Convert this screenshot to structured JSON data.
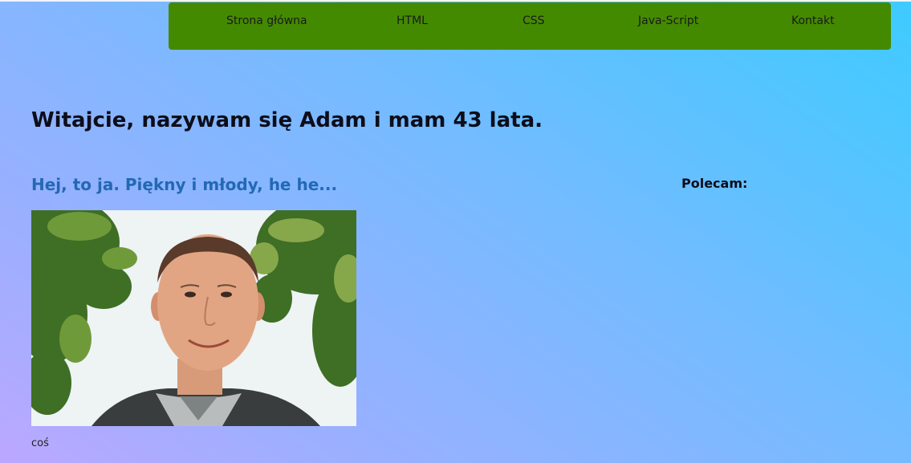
{
  "nav": {
    "items": [
      "Strona główna",
      "HTML",
      "CSS",
      "Java-Script",
      "Kontakt"
    ]
  },
  "main": {
    "title": "Witajcie, nazywam się Adam i mam 43 lata.",
    "photo_heading": "Hej, to ja. Piękny i młody, he he...",
    "caption": "coś"
  },
  "sidebar": {
    "heading": "Polecam:"
  },
  "colors": {
    "nav_background": "#448a00",
    "heading_blue": "#2368b4",
    "gradient_start": "#bba8ff",
    "gradient_end": "#3ecbff"
  }
}
